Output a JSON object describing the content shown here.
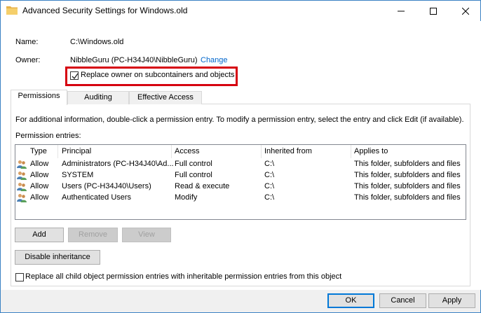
{
  "window": {
    "title": "Advanced Security Settings for Windows.old",
    "minimize": "—",
    "maximize": "☐",
    "close": "✕"
  },
  "name_row": {
    "label": "Name:",
    "value": "C:\\Windows.old"
  },
  "owner_row": {
    "label": "Owner:",
    "value": "NibbleGuru (PC-H34J40\\NibbleGuru)",
    "change_link": "Change"
  },
  "replace_owner": {
    "label": "Replace owner on subcontainers and objects",
    "checked": true
  },
  "tabs": [
    {
      "label": "Permissions",
      "active": true
    },
    {
      "label": "Auditing",
      "active": false
    },
    {
      "label": "Effective Access",
      "active": false
    }
  ],
  "info_text": "For additional information, double-click a permission entry. To modify a permission entry, select the entry and click Edit (if available).",
  "entries_label": "Permission entries:",
  "columns": [
    "Type",
    "Principal",
    "Access",
    "Inherited from",
    "Applies to"
  ],
  "entries": [
    {
      "type": "Allow",
      "principal": "Administrators (PC-H34J40\\Ad...",
      "access": "Full control",
      "inherited": "C:\\",
      "applies": "This folder, subfolders and files"
    },
    {
      "type": "Allow",
      "principal": "SYSTEM",
      "access": "Full control",
      "inherited": "C:\\",
      "applies": "This folder, subfolders and files"
    },
    {
      "type": "Allow",
      "principal": "Users (PC-H34J40\\Users)",
      "access": "Read & execute",
      "inherited": "C:\\",
      "applies": "This folder, subfolders and files"
    },
    {
      "type": "Allow",
      "principal": "Authenticated Users",
      "access": "Modify",
      "inherited": "C:\\",
      "applies": "This folder, subfolders and files"
    }
  ],
  "buttons": {
    "add": "Add",
    "remove": "Remove",
    "view": "View",
    "disable_inheritance": "Disable inheritance",
    "ok": "OK",
    "cancel": "Cancel",
    "apply": "Apply"
  },
  "replace_child": {
    "label": "Replace all child object permission entries with inheritable permission entries from this object",
    "checked": false
  },
  "colors": {
    "highlight": "#d6000f",
    "link": "#0066cc",
    "window_border": "#3b82c4"
  },
  "icons": {
    "app": "folder-icon",
    "principal": "users-icon"
  }
}
